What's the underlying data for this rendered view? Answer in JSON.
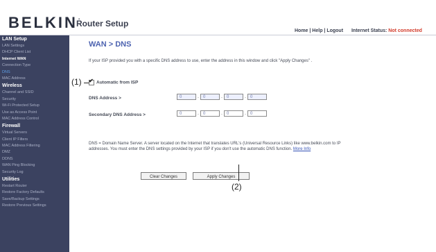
{
  "header": {
    "logo": "BELKIN",
    "logo_mark": ".",
    "app_title": "Router Setup",
    "links": "Home | Help | Logout",
    "status_label": "Internet Status:",
    "status_value": "Not connected"
  },
  "sidebar": {
    "lan_setup": "LAN Setup",
    "lan_settings": "LAN Settings",
    "dhcp_client_list": "DHCP Client List",
    "internet_wan": "Internet WAN",
    "connection_type": "Connection Type",
    "dns": "DNS",
    "mac_address": "MAC Address",
    "wireless": "Wireless",
    "channel_ssid": "Channel and SSID",
    "security": "Security",
    "wifi_protected": "Wi-Fi Protected Setup",
    "access_point": "Use as Access Point",
    "mac_control": "MAC Address Control",
    "firewall": "Firewall",
    "virtual_servers": "Virtual Servers",
    "client_ip_filters": "Client IP Filters",
    "mac_filtering": "MAC Address Filtering",
    "dmz": "DMZ",
    "ddns": "DDNS",
    "wan_ping": "WAN Ping Blocking",
    "security_log": "Security Log",
    "utilities": "Utilities",
    "restart_router": "Restart Router",
    "restore_defaults": "Restore Factory Defaults",
    "save_backup": "Save/Backup Settings",
    "restore_previous": "Restore Previous Settings"
  },
  "main": {
    "title": "WAN > DNS",
    "intro": "If your ISP provided you with a specific DNS address to use, enter the address in this window and click \"Apply Changes\" .",
    "automatic_label": "Automatic from ISP",
    "dns_label": "DNS Address >",
    "secondary_label": "Secondary DNS Address >",
    "dns_values": [
      "0",
      "0",
      "0",
      "0"
    ],
    "secondary_values": [
      "0",
      "0",
      "0",
      "0"
    ],
    "note": "DNS = Domain Name Server. A server located on the Internet that translates URL's (Universal Resource Links) like www.belkin.com to IP addresses. You must enter the DNS settings provided by your ISP if you don't use the automatic DNS function.",
    "more_info": "More Info",
    "clear_button": "Clear Changes",
    "apply_button": "Apply Changes"
  },
  "callouts": {
    "one": "(1)",
    "two": "(2)"
  }
}
